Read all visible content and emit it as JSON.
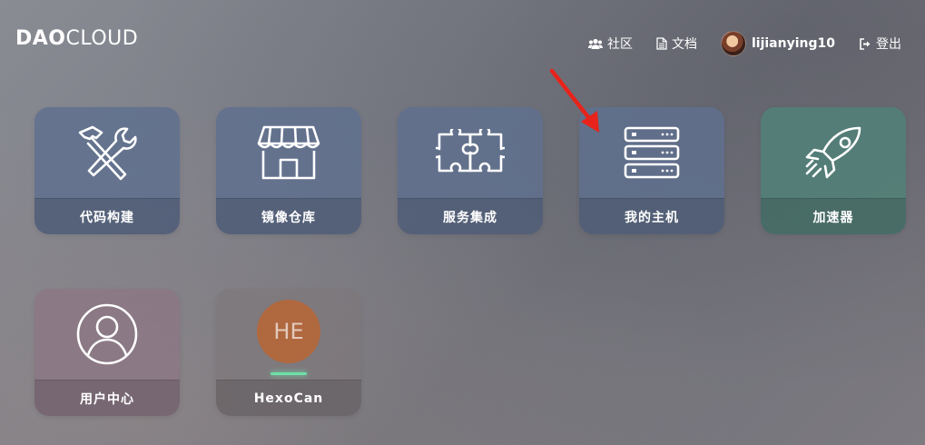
{
  "brand": {
    "bold": "DAO",
    "light": "CLOUD"
  },
  "nav": {
    "community": {
      "label": "社区",
      "icon": "users-icon"
    },
    "docs": {
      "label": "文档",
      "icon": "document-icon"
    },
    "user": {
      "label": "lijianying10",
      "icon": "avatar"
    },
    "logout": {
      "label": "登出",
      "icon": "sign-out-icon"
    }
  },
  "tiles": [
    {
      "label": "代码构建",
      "icon": "hammer-wrench-icon",
      "color": "#5f708e"
    },
    {
      "label": "镜像仓库",
      "icon": "storefront-icon",
      "color": "#5f708e"
    },
    {
      "label": "服务集成",
      "icon": "puzzle-icon",
      "color": "#5f708e"
    },
    {
      "label": "我的主机",
      "icon": "server-icon",
      "color": "#5f708e"
    },
    {
      "label": "加速器",
      "icon": "rocket-icon",
      "color": "#528078"
    },
    {
      "label": "用户中心",
      "icon": "user-circle-icon",
      "color": "#8c7684"
    },
    {
      "label": "HexoCan",
      "icon": "app-initials",
      "initials": "HE",
      "color": "#b0683f",
      "status_color": "#6ee0a8"
    }
  ],
  "annotation": {
    "arrow_color": "#e8231b"
  }
}
